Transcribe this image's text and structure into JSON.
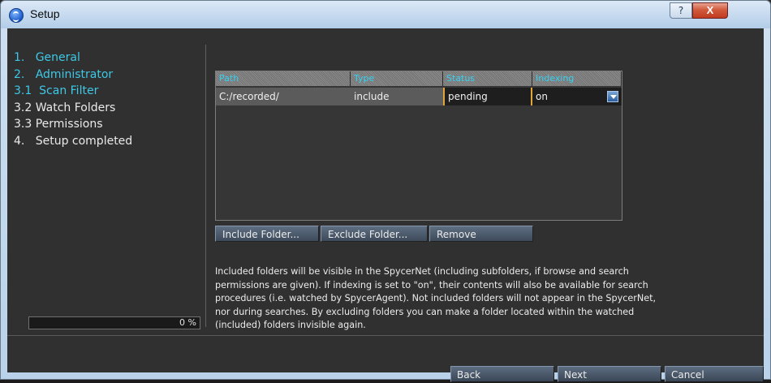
{
  "window": {
    "title": "Setup",
    "help_label": "?",
    "close_label": "X"
  },
  "steps": [
    {
      "label": "1.   General",
      "state": "done"
    },
    {
      "label": "2.   Administrator",
      "state": "done"
    },
    {
      "label": "3.1  Scan Filter",
      "state": "done"
    },
    {
      "label": "3.2 Watch Folders",
      "state": "todo"
    },
    {
      "label": "3.3 Permissions",
      "state": "todo"
    },
    {
      "label": "4.   Setup completed",
      "state": "todo"
    }
  ],
  "progress": {
    "value_percent": 0,
    "label": "0 %"
  },
  "table": {
    "columns": [
      "Path",
      "Type",
      "Status",
      "Indexing"
    ],
    "rows": [
      {
        "path": "C:/recorded/",
        "type": "include",
        "status": "pending",
        "indexing": "on"
      }
    ]
  },
  "buttons": {
    "include_folder": "Include Folder...",
    "exclude_folder": "Exclude Folder...",
    "remove": "Remove",
    "back": "Back",
    "next": "Next",
    "cancel": "Cancel"
  },
  "description": "Included folders will be visible in the SpycerNet (including subfolders, if browse and search permissions are given). If indexing is set to \"on\", their contents will also be available for search procedures (i.e. watched by SpycerAgent). Not included folders will not appear in the SpycerNet, nor during searches. By excluding folders you can make a folder located within the watched (included) folders invisible again.",
  "colors": {
    "accent_done": "#3ec8e6",
    "header_text": "#35d0f0",
    "status_border": "#e3a43a",
    "client_bg": "#303030"
  }
}
